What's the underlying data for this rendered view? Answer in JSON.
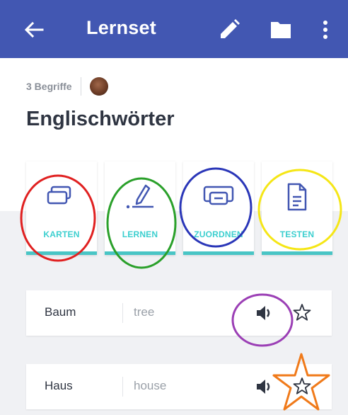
{
  "header": {
    "title": "Lernset",
    "icons": [
      "back-arrow-icon",
      "pencil-icon",
      "folder-icon",
      "more-vert-icon"
    ],
    "background": "#4257b2"
  },
  "set": {
    "term_count": "3 Begriffe",
    "title": "Englischwörter"
  },
  "modes": [
    {
      "label": "KARTEN",
      "icon": "cards-icon"
    },
    {
      "label": "LERNEN",
      "icon": "learn-icon"
    },
    {
      "label": "ZUORDNEN",
      "icon": "match-icon"
    },
    {
      "label": "TESTEN",
      "icon": "test-icon"
    }
  ],
  "terms": [
    {
      "word": "Baum",
      "definition": "tree"
    },
    {
      "word": "Haus",
      "definition": "house"
    }
  ],
  "colors": {
    "accent": "#3ccfcf",
    "annotation_red": "#e02020",
    "annotation_green": "#2aa02a",
    "annotation_blue": "#2a36b8",
    "annotation_yellow": "#f5e616",
    "annotation_purple": "#9b3fb5",
    "annotation_orange": "#f07a1a"
  }
}
